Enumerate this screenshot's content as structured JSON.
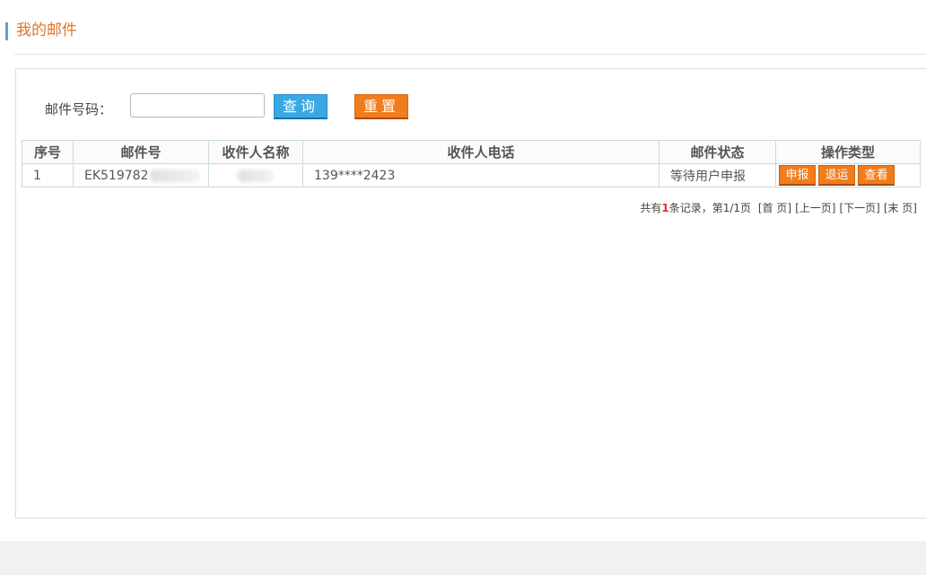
{
  "header": {
    "title": "我的邮件"
  },
  "search": {
    "label": "邮件号码：",
    "value": "",
    "placeholder": "",
    "query_label": "查询",
    "reset_label": "重置"
  },
  "table": {
    "columns": [
      "序号",
      "邮件号",
      "收件人名称",
      "收件人电话",
      "邮件状态",
      "操作类型"
    ],
    "rows": [
      {
        "index": "1",
        "mail_no_visible": "EK519782",
        "recipient_name_visible": "",
        "phone": "139****2423",
        "status": "等待用户申报",
        "actions": [
          "申报",
          "退运",
          "查看"
        ]
      }
    ]
  },
  "pagination": {
    "prefix": "共有",
    "count": "1",
    "suffix": "条记录，第1/1页",
    "first": "[首 页]",
    "prev": "[上一页]",
    "next": "[下一页]",
    "last": "[末 页]"
  },
  "colors": {
    "title": "#e0742a",
    "accent_bar": "#5aa0e0",
    "query_button": "#3aa8e4",
    "reset_button": "#f17c1c",
    "action_button": "#f17c1c",
    "count_highlight": "#e0302a"
  }
}
